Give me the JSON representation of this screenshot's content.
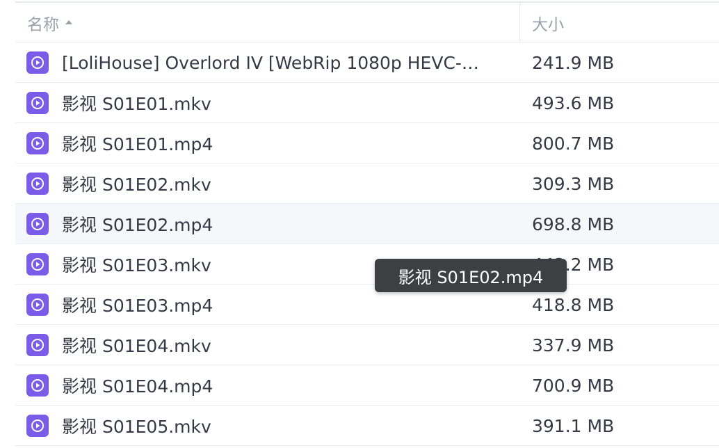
{
  "header": {
    "name_label": "名称",
    "size_label": "大小",
    "sort": "ascending"
  },
  "files": [
    {
      "name": "[LoliHouse] Overlord IV [WebRip 1080p HEVC-…",
      "size": "241.9 MB",
      "icon": "video-file-icon"
    },
    {
      "name": "影视 S01E01.mkv",
      "size": "493.6 MB",
      "icon": "video-file-icon"
    },
    {
      "name": "影视 S01E01.mp4",
      "size": "800.7 MB",
      "icon": "video-file-icon"
    },
    {
      "name": "影视 S01E02.mkv",
      "size": "309.3 MB",
      "icon": "video-file-icon"
    },
    {
      "name": "影视 S01E02.mp4",
      "size": "698.8 MB",
      "icon": "video-file-icon"
    },
    {
      "name": "影视 S01E03.mkv",
      "size": "442.2 MB",
      "icon": "video-file-icon"
    },
    {
      "name": "影视 S01E03.mp4",
      "size": "418.8 MB",
      "icon": "video-file-icon"
    },
    {
      "name": "影视 S01E04.mkv",
      "size": "337.9 MB",
      "icon": "video-file-icon"
    },
    {
      "name": "影视 S01E04.mp4",
      "size": "700.9 MB",
      "icon": "video-file-icon"
    },
    {
      "name": "影视 S01E05.mkv",
      "size": "391.1 MB",
      "icon": "video-file-icon"
    }
  ],
  "tooltip": {
    "text": "影视 S01E02.mp4"
  },
  "colors": {
    "icon_bg": "#7b5ce8",
    "tooltip_bg": "#3e3f42",
    "hover_row_bg": "#f5f7fb"
  }
}
